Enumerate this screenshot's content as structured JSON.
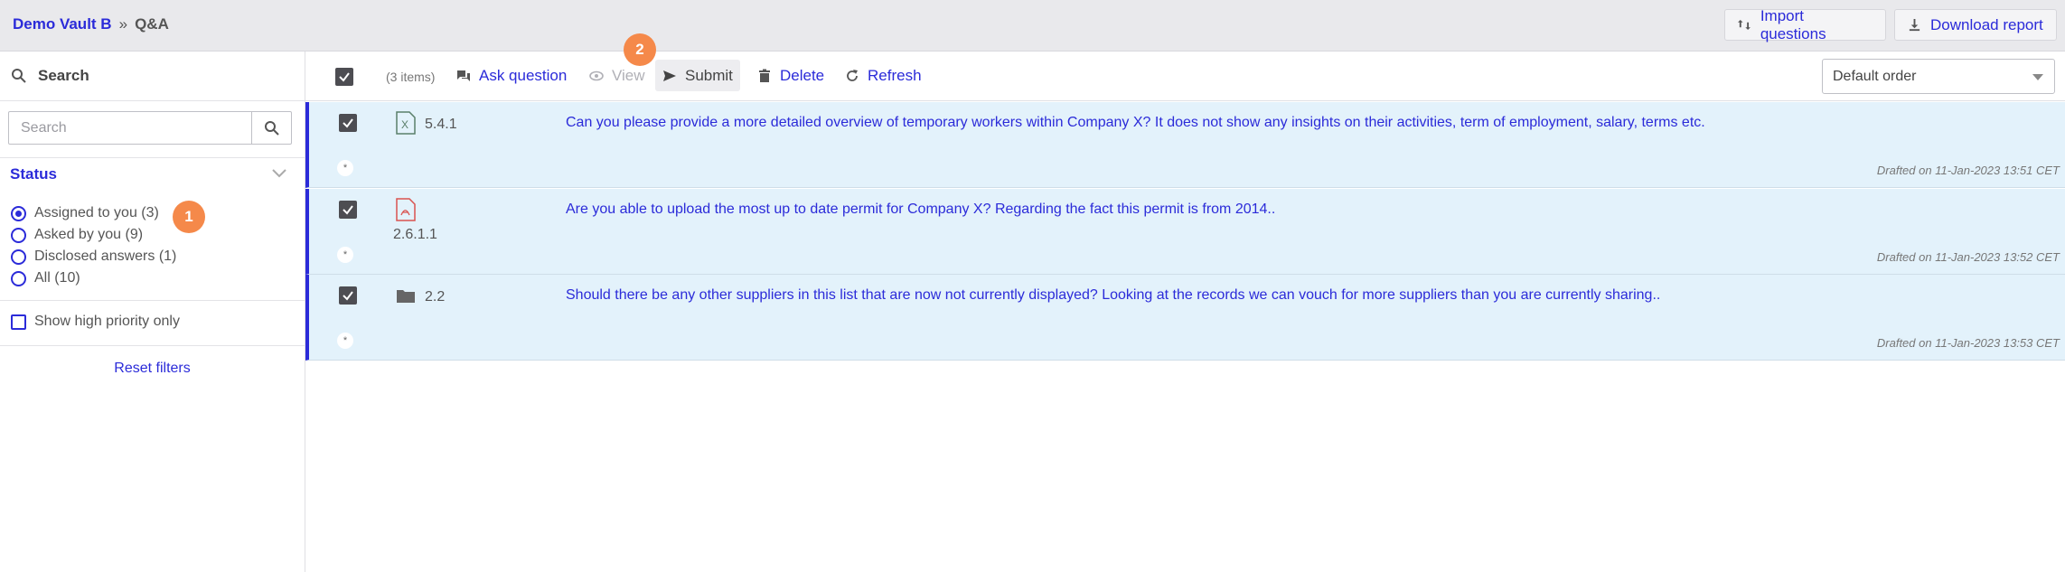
{
  "header": {
    "vault": "Demo Vault B",
    "separator": "»",
    "page": "Q&A",
    "import_label": "Import questions",
    "download_label": "Download report"
  },
  "sidebar": {
    "search_title": "Search",
    "search_placeholder": "Search",
    "status_title": "Status",
    "status_options": [
      {
        "label": "Assigned to you (3)",
        "selected": true
      },
      {
        "label": "Asked by you (9)",
        "selected": false
      },
      {
        "label": "Disclosed answers (1)",
        "selected": false
      },
      {
        "label": "All (10)",
        "selected": false
      }
    ],
    "high_priority_label": "Show high priority only",
    "reset_label": "Reset filters"
  },
  "toolbar": {
    "items_count": "(3 items)",
    "ask_label": "Ask question",
    "view_label": "View",
    "submit_label": "Submit",
    "delete_label": "Delete",
    "refresh_label": "Refresh",
    "order_value": "Default order"
  },
  "badges": {
    "one": "1",
    "two": "2"
  },
  "rows": [
    {
      "ref": "5.4.1",
      "file_icon": "excel-file-icon",
      "question": "Can you please provide a more detailed overview of temporary workers within Company X? It does not show any insights on their activities, term of employment, salary, terms etc.",
      "flag": "*",
      "drafted": "Drafted on 11-Jan-2023 13:51 CET"
    },
    {
      "ref": "2.6.1.1",
      "file_icon": "pdf-file-icon",
      "question": "Are you able to upload the most up to date permit for Company X? Regarding the fact this permit is from 2014..",
      "flag": "*",
      "drafted": "Drafted on 11-Jan-2023 13:52 CET"
    },
    {
      "ref": "2.2",
      "file_icon": "folder-icon",
      "question": "Should there be any other suppliers in this list that are now not currently displayed? Looking at the records we can vouch for more suppliers than you are currently sharing..",
      "flag": "*",
      "drafted": "Drafted on 11-Jan-2023 13:53 CET"
    }
  ],
  "colors": {
    "accent": "#2b2bd9",
    "row_bg": "#e3f2fb",
    "badge": "#f5894a"
  }
}
